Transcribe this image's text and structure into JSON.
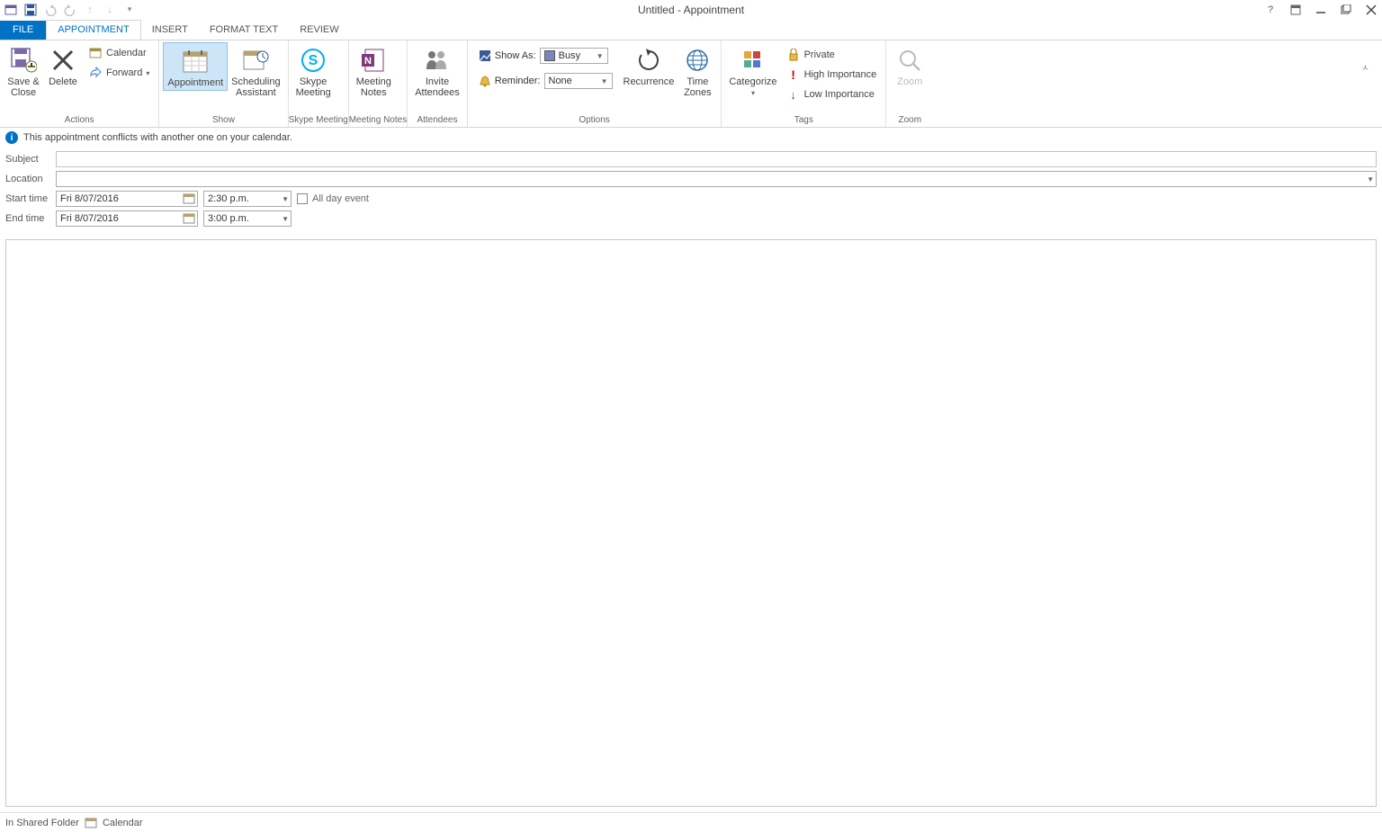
{
  "title": "Untitled - Appointment",
  "tabs": {
    "file": "FILE",
    "appointment": "APPOINTMENT",
    "insert": "INSERT",
    "formattext": "FORMAT TEXT",
    "review": "REVIEW"
  },
  "ribbon": {
    "actions": {
      "label": "Actions",
      "saveclose": "Save & Close",
      "delete": "Delete",
      "calendar": "Calendar",
      "forward": "Forward"
    },
    "show": {
      "label": "Show",
      "appointment": "Appointment",
      "scheduling": "Scheduling Assistant"
    },
    "skype": {
      "label": "Skype Meeting",
      "btn": "Skype Meeting"
    },
    "notes": {
      "label": "Meeting Notes",
      "btn": "Meeting Notes"
    },
    "attendees": {
      "label": "Attendees",
      "btn": "Invite Attendees"
    },
    "options": {
      "label": "Options",
      "showas_lbl": "Show As:",
      "showas_val": "Busy",
      "reminder_lbl": "Reminder:",
      "reminder_val": "None",
      "recurrence": "Recurrence",
      "timezones": "Time Zones"
    },
    "tags": {
      "label": "Tags",
      "categorize": "Categorize",
      "private": "Private",
      "high": "High Importance",
      "low": "Low Importance"
    },
    "zoom": {
      "label": "Zoom",
      "btn": "Zoom"
    }
  },
  "info": "This appointment conflicts with another one on your calendar.",
  "form": {
    "subject_lbl": "Subject",
    "subject_val": "",
    "location_lbl": "Location",
    "location_val": "",
    "start_lbl": "Start time",
    "start_date": "Fri 8/07/2016",
    "start_time": "2:30 p.m.",
    "end_lbl": "End time",
    "end_date": "Fri 8/07/2016",
    "end_time": "3:00 p.m.",
    "allday": "All day event"
  },
  "status": {
    "folder_lbl": "In Shared Folder",
    "folder_name": "Calendar"
  }
}
